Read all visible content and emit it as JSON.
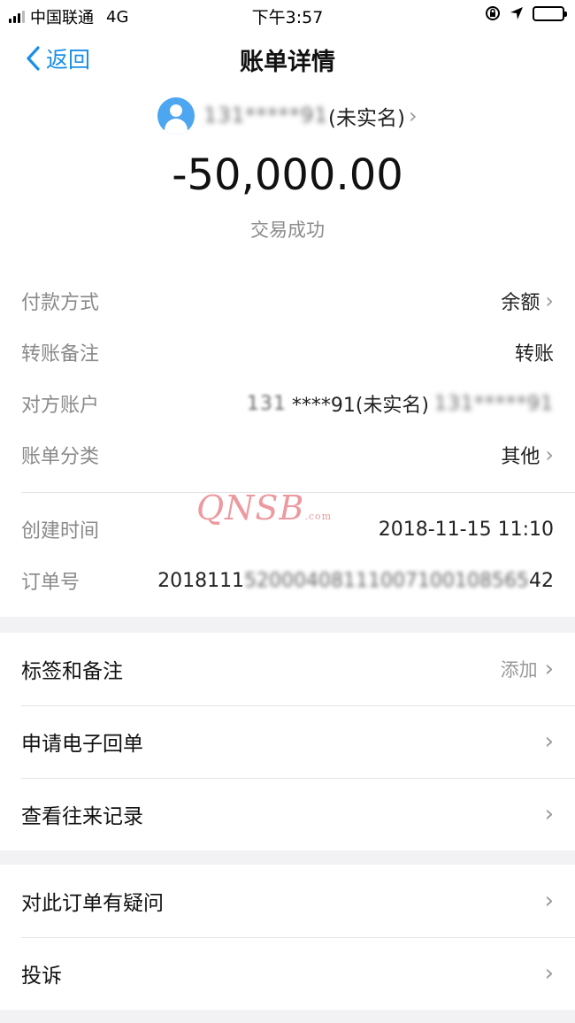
{
  "status_bar": {
    "carrier": "中国联通",
    "network": "4G",
    "time": "下午3:57"
  },
  "nav": {
    "back_label": "返回",
    "title": "账单详情"
  },
  "summary": {
    "payee_masked": "131*****91",
    "payee_suffix": "(未实名)",
    "amount": "-50,000.00",
    "status": "交易成功"
  },
  "details": [
    {
      "label": "付款方式",
      "value": "余额",
      "has_arrow": true
    },
    {
      "label": "转账备注",
      "value": "转账",
      "has_arrow": false
    },
    {
      "label": "对方账户",
      "value_pre": "131",
      "value_mid": "****91(未实名)",
      "value_post": "131*****91",
      "has_arrow": false
    },
    {
      "label": "账单分类",
      "value": "其他",
      "has_arrow": true
    },
    {
      "label": "创建时间",
      "value": "2018-11-15 11:10",
      "has_arrow": false
    },
    {
      "label": "订单号",
      "value_pre": "2018111",
      "value_blur": "52000408111007100108565",
      "value_post": "42",
      "has_arrow": false
    }
  ],
  "watermark": {
    "text": "QNSB",
    "sub": ".com"
  },
  "actions_group1": [
    {
      "label": "标签和备注",
      "hint": "添加"
    },
    {
      "label": "申请电子回单",
      "hint": ""
    },
    {
      "label": "查看往来记录",
      "hint": ""
    }
  ],
  "actions_group2": [
    {
      "label": "对此订单有疑问",
      "hint": ""
    },
    {
      "label": "投诉",
      "hint": ""
    }
  ],
  "icons": [
    "signal-icon",
    "location-lock-icon",
    "navigation-arrow-icon",
    "battery-icon",
    "back-chevron-icon",
    "avatar-icon",
    "chevron-right-icon"
  ],
  "colors": {
    "accent": "#1a8fe8",
    "avatar": "#4da6f0",
    "watermark": "#dc4650"
  }
}
